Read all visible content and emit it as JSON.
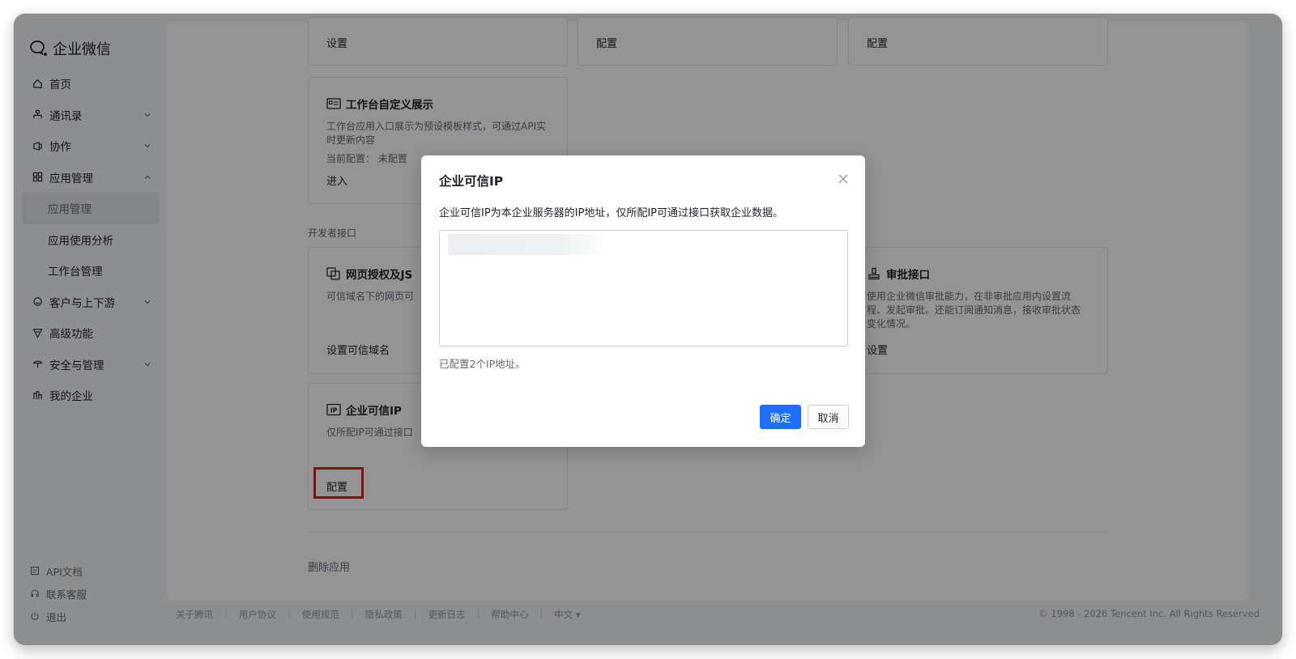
{
  "app": {
    "logo_text": "企业微信"
  },
  "sidebar": {
    "items": [
      {
        "label": "首页",
        "icon": "home-icon"
      },
      {
        "label": "通讯录",
        "icon": "contacts-icon",
        "expandable": true
      },
      {
        "label": "协作",
        "icon": "collab-icon",
        "expandable": true
      },
      {
        "label": "应用管理",
        "icon": "apps-icon",
        "expandable": true,
        "expanded": true
      },
      {
        "label": "应用管理",
        "sub": true,
        "active": true
      },
      {
        "label": "应用使用分析",
        "sub": true
      },
      {
        "label": "工作台管理",
        "sub": true
      },
      {
        "label": "客户与上下游",
        "icon": "customer-icon",
        "expandable": true
      },
      {
        "label": "高级功能",
        "icon": "advanced-icon"
      },
      {
        "label": "安全与管理",
        "icon": "security-icon",
        "expandable": true
      },
      {
        "label": "我的企业",
        "icon": "company-icon"
      }
    ],
    "bottom": [
      {
        "label": "API文档",
        "icon": "doc-icon"
      },
      {
        "label": "联系客服",
        "icon": "support-icon"
      },
      {
        "label": "退出",
        "icon": "power-icon"
      }
    ]
  },
  "content": {
    "top_cards": [
      {
        "link": "设置"
      },
      {
        "link": "配置"
      },
      {
        "link": "配置"
      }
    ],
    "workbench_card": {
      "title": "工作台自定义展示",
      "desc": "工作台应用入口展示为预设模板样式，可通过API实时更新内容",
      "current_label": "当前配置：",
      "current_value": "未配置",
      "link": "进入"
    },
    "dev_section_label": "开发者接口",
    "web_auth_card": {
      "title": "网页授权及JS",
      "desc": "可信域名下的网页可",
      "link": "设置可信域名"
    },
    "approval_card": {
      "title": "审批接口",
      "desc": "使用企业微信审批能力，在非审批应用内设置流程、发起审批。还能订阅通知消息，接收审批状态变化情况。",
      "link": "设置"
    },
    "trusted_ip_card": {
      "title": "企业可信IP",
      "desc": "仅所配IP可通过接口",
      "link": "配置"
    },
    "delete_label": "删除应用"
  },
  "footer": {
    "links": [
      "关于腾讯",
      "用户协议",
      "使用规范",
      "隐私政策",
      "更新日志",
      "帮助中心",
      "中文"
    ],
    "copyright": "© 1998 - 2026 Tencent Inc. All Rights Reserved"
  },
  "modal": {
    "title": "企业可信IP",
    "description": "企业可信IP为本企业服务器的IP地址，仅所配IP可通过接口获取企业数据。",
    "textarea_value": "",
    "count_text": "已配置2个IP地址。",
    "ok_label": "确定",
    "cancel_label": "取消"
  },
  "colors": {
    "primary": "#1e6fff",
    "highlight": "#e02020"
  }
}
